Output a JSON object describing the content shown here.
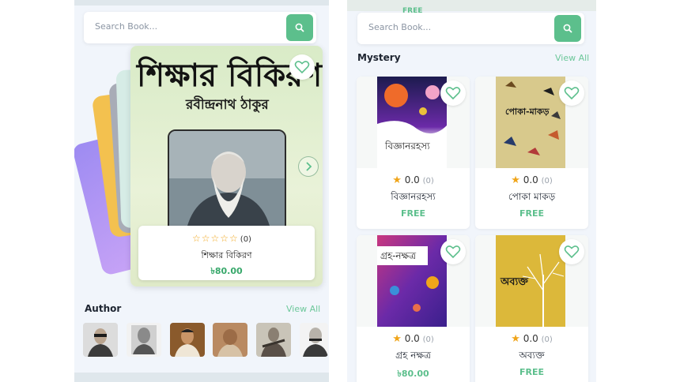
{
  "left": {
    "search": {
      "placeholder": "Search Book..."
    },
    "featured": {
      "cover_title": "শিক্ষার বিকিরণ",
      "cover_author": "রবীন্দ্রনাথ ঠাকুর",
      "stars": "☆☆☆☆☆",
      "rating_count": "(0)",
      "name": "শিক্ষার বিকিরণ",
      "price": "৳80.00"
    },
    "author_section": {
      "title": "Author",
      "view_all": "View All"
    }
  },
  "right": {
    "search": {
      "placeholder": "Search Book..."
    },
    "top_badge": "FREE",
    "section": {
      "title": "Mystery",
      "view_all": "View All"
    },
    "books": [
      {
        "title": "বিজ্ঞানরহস্য",
        "cover_text": "বিজ্ঞানরহস্য",
        "rating": "0.0",
        "count": "(0)",
        "price": "FREE"
      },
      {
        "title": "পোকা মাকড়",
        "cover_text": "পোকা-মাকড়",
        "rating": "0.0",
        "count": "(0)",
        "price": "FREE"
      },
      {
        "title": "গ্রহ নক্ষত্র",
        "cover_text": "গ্রহ-নক্ষত্র",
        "rating": "0.0",
        "count": "(0)",
        "price": "৳80.00"
      },
      {
        "title": "অব্যক্ত",
        "cover_text": "অব্যক্ত",
        "rating": "0.0",
        "count": "(0)",
        "price": "FREE"
      }
    ]
  },
  "colors": {
    "accent": "#5cbf8c",
    "star": "#f0a51a",
    "background": "#f1f5fb"
  },
  "icons": [
    "search-icon",
    "heart-icon",
    "chevron-right-icon",
    "star-icon"
  ]
}
